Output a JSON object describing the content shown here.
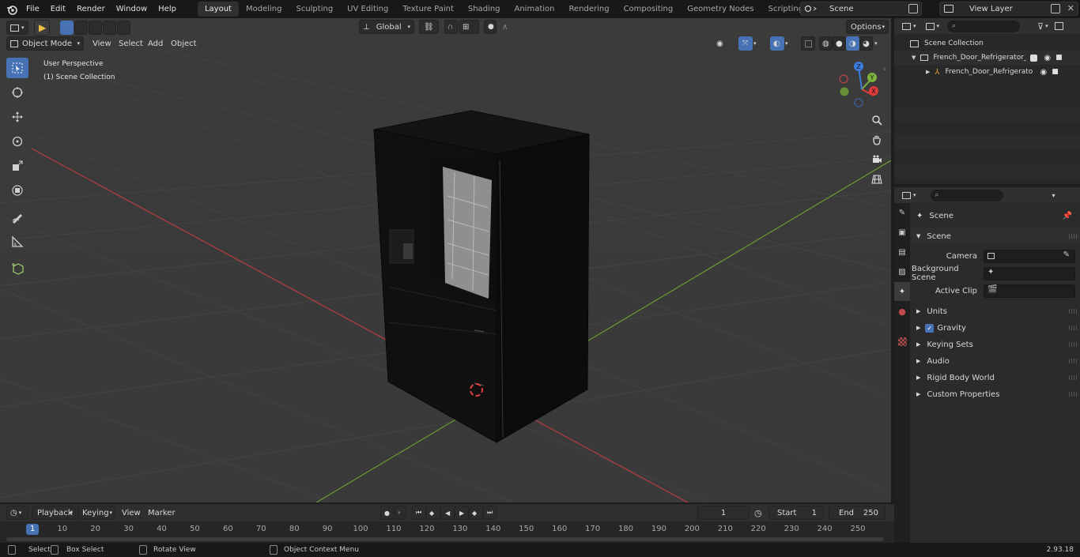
{
  "topbar": {
    "menus": [
      "File",
      "Edit",
      "Render",
      "Window",
      "Help"
    ],
    "workspaces": [
      "Layout",
      "Modeling",
      "Sculpting",
      "UV Editing",
      "Texture Paint",
      "Shading",
      "Animation",
      "Rendering",
      "Compositing",
      "Geometry Nodes",
      "Scripting"
    ],
    "active_workspace": "Layout",
    "scene_name": "Scene",
    "view_layer": "View Layer"
  },
  "viewport": {
    "mode": "Object Mode",
    "menus": [
      "View",
      "Select",
      "Add",
      "Object"
    ],
    "transform_orientation": "Global",
    "options_label": "Options",
    "perspective_label": "User Perspective",
    "collection_label": "(1) Scene Collection",
    "gizmo_axes": {
      "x": "X",
      "y": "Y",
      "z": "Z"
    },
    "colors": {
      "accent": "#4772b3",
      "x_axis": "#e03c3c",
      "y_axis": "#7cb33c",
      "z_axis": "#3c7ee0",
      "background": "#393939"
    }
  },
  "outliner": {
    "root": "Scene Collection",
    "items": [
      {
        "label": "French_Door_Refrigerator_Sa"
      },
      {
        "label": "French_Door_Refrigerato"
      }
    ]
  },
  "properties": {
    "context_title": "Scene",
    "panel_title": "Scene",
    "fields": [
      {
        "label": "Camera"
      },
      {
        "label": "Background Scene"
      },
      {
        "label": "Active Clip"
      }
    ],
    "sections": [
      "Units",
      "Gravity",
      "Keying Sets",
      "Audio",
      "Rigid Body World",
      "Custom Properties"
    ]
  },
  "timeline": {
    "menus": [
      "Playback",
      "Keying",
      "View",
      "Marker"
    ],
    "current_frame": "1",
    "start_label": "Start",
    "start_value": "1",
    "end_label": "End",
    "end_value": "250",
    "ruler_current": "1",
    "ruler_ticks": [
      "10",
      "20",
      "30",
      "40",
      "50",
      "60",
      "70",
      "80",
      "90",
      "100",
      "110",
      "120",
      "130",
      "140",
      "150",
      "160",
      "170",
      "180",
      "190",
      "200",
      "210",
      "220",
      "230",
      "240",
      "250"
    ]
  },
  "statusbar": {
    "select": "Select",
    "box_select": "Box Select",
    "rotate_view": "Rotate View",
    "context_menu": "Object Context Menu",
    "version": "2.93.18"
  }
}
